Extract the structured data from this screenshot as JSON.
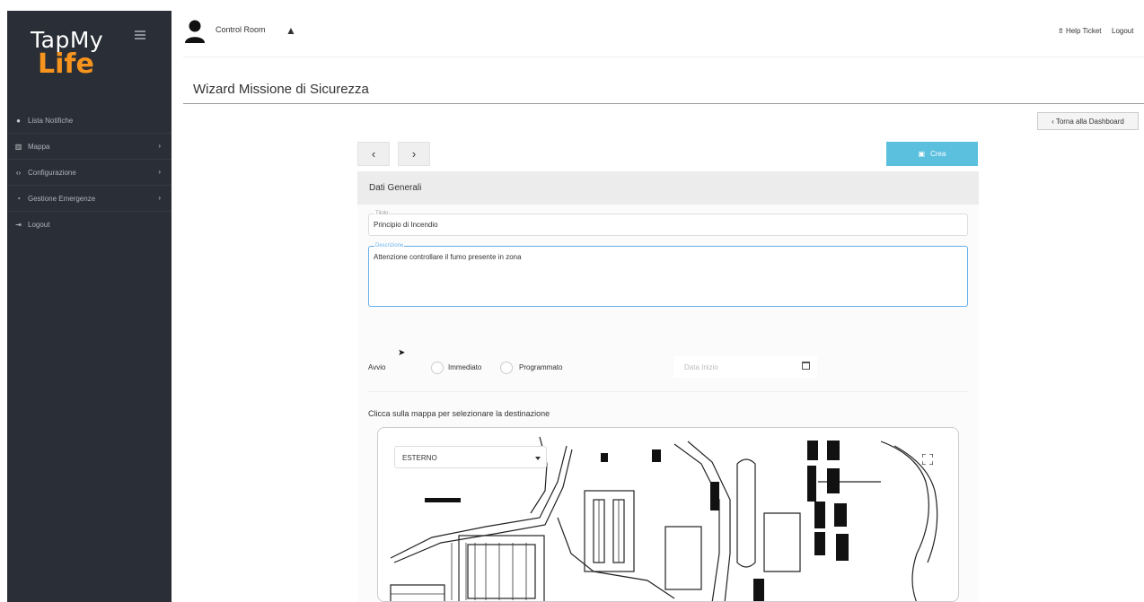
{
  "sidebar": {
    "logo_line1": "TapMy",
    "logo_line2": "Life",
    "items": [
      {
        "label": "Lista Notifiche",
        "icon": "bell-icon"
      },
      {
        "label": "Mappa",
        "icon": "map-icon"
      },
      {
        "label": "Configurazione",
        "icon": "code-icon"
      },
      {
        "label": "Gestione Emergenze",
        "icon": "gauge-icon"
      },
      {
        "label": "Logout",
        "icon": "logout-icon"
      }
    ]
  },
  "header": {
    "title": "Control Room",
    "help_label": "Help Ticket",
    "logout_label": "Logout"
  },
  "page": {
    "title": "Wizard Missione di Sicurezza",
    "back_label": "Torna alla Dashboard"
  },
  "wizard": {
    "prev_label": "‹",
    "next_label": "›",
    "create_label": "Crea",
    "section_title": "Dati Generali",
    "title_field": {
      "legend": "Titolo",
      "value": "Principio di Incendio"
    },
    "description_field": {
      "legend": "Descrizione",
      "value": "Attenzione controllare il fumo presente in zona"
    },
    "start_label": "Avvio",
    "radio_immediate": "Immediato",
    "radio_scheduled": "Programmato",
    "date_placeholder": "Data Inizio",
    "map_caption": "Clicca sulla mappa per selezionare la destinazione",
    "map_select_value": "ESTERNO"
  },
  "colors": {
    "sidebar_bg": "#2a2e36",
    "brand_orange": "#f7941d",
    "primary_button": "#5bc0de"
  }
}
